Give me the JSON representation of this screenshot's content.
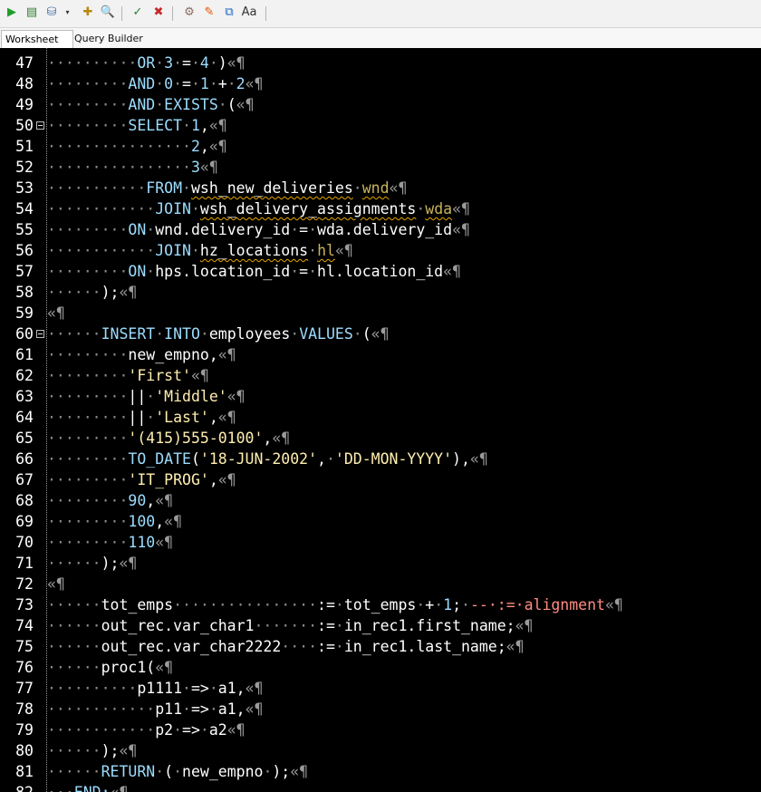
{
  "toolbar": {
    "buttons": [
      {
        "icon": "run-statement-icon",
        "glyph": "▶",
        "color": "#1f9d2b"
      },
      {
        "icon": "run-script-icon",
        "glyph": "▤",
        "color": "#2f7d2f"
      },
      {
        "icon": "commit-icon",
        "glyph": "⛁",
        "color": "#486fa8"
      },
      {
        "icon": "dropdown-arrow-icon",
        "glyph": "▾",
        "color": "#333333"
      },
      {
        "icon": "explain-plan-icon",
        "glyph": "✚",
        "color": "#b8860b"
      },
      {
        "icon": "autotrace-icon",
        "glyph": "🔍",
        "color": "#555555"
      },
      {
        "icon": "rollback-icon",
        "glyph": "✓",
        "color": "#2e7d32"
      },
      {
        "icon": "stop-icon",
        "glyph": "✖",
        "color": "#c62828"
      },
      {
        "icon": "sql-tuning-icon",
        "glyph": "⚙",
        "color": "#8d6e63"
      },
      {
        "icon": "clear-icon",
        "glyph": "✎",
        "color": "#e65100"
      },
      {
        "icon": "history-icon",
        "glyph": "⧉",
        "color": "#1565c0"
      },
      {
        "icon": "change-case-icon",
        "glyph": "Aa",
        "color": "#333333"
      }
    ]
  },
  "tabs": [
    {
      "label": "Worksheet",
      "active": true
    },
    {
      "label": "Query Builder",
      "active": false
    }
  ],
  "colors": {
    "background": "#000000",
    "keyword": "#9cdcfe",
    "string": "#ffeeb0",
    "comment": "#ff8c82",
    "whitespace_marker": "#8b8b8b",
    "squiggle": "#e6a400"
  },
  "editor": {
    "first_visible_line": 47,
    "lines": [
      {
        "n": "47",
        "fold": false,
        "tokens": [
          [
            "ws",
            "·········"
          ],
          [
            "ws",
            "·"
          ],
          [
            "kw",
            "OR"
          ],
          [
            "ws",
            "·"
          ],
          [
            "num",
            "3"
          ],
          [
            "ws",
            "·"
          ],
          [
            "op",
            "="
          ],
          [
            "ws",
            "·"
          ],
          [
            "num",
            "4"
          ],
          [
            "ws",
            "·"
          ],
          [
            "tx",
            ")"
          ],
          [
            "pm",
            "«¶"
          ]
        ]
      },
      {
        "n": "48",
        "fold": false,
        "tokens": [
          [
            "ws",
            "·········"
          ],
          [
            "kw",
            "AND"
          ],
          [
            "ws",
            "·"
          ],
          [
            "num",
            "0"
          ],
          [
            "ws",
            "·"
          ],
          [
            "op",
            "="
          ],
          [
            "ws",
            "·"
          ],
          [
            "num",
            "1"
          ],
          [
            "ws",
            "·"
          ],
          [
            "op",
            "+"
          ],
          [
            "ws",
            "·"
          ],
          [
            "num",
            "2"
          ],
          [
            "pm",
            "«¶"
          ]
        ]
      },
      {
        "n": "49",
        "fold": false,
        "tokens": [
          [
            "ws",
            "·········"
          ],
          [
            "kw",
            "AND"
          ],
          [
            "ws",
            "·"
          ],
          [
            "kw",
            "EXISTS"
          ],
          [
            "ws",
            "·"
          ],
          [
            "tx",
            "("
          ],
          [
            "pm",
            "«¶"
          ]
        ]
      },
      {
        "n": "50",
        "fold": true,
        "tokens": [
          [
            "ws",
            "·········"
          ],
          [
            "kw",
            "SELECT"
          ],
          [
            "ws",
            "·"
          ],
          [
            "num",
            "1"
          ],
          [
            "tx",
            ","
          ],
          [
            "pm",
            "«¶"
          ]
        ]
      },
      {
        "n": "51",
        "fold": false,
        "tokens": [
          [
            "ws",
            "················"
          ],
          [
            "num",
            "2"
          ],
          [
            "tx",
            ","
          ],
          [
            "pm",
            "«¶"
          ]
        ]
      },
      {
        "n": "52",
        "fold": false,
        "tokens": [
          [
            "ws",
            "················"
          ],
          [
            "num",
            "3"
          ],
          [
            "pm",
            "«¶"
          ]
        ]
      },
      {
        "n": "53",
        "fold": false,
        "tokens": [
          [
            "ws",
            "···········"
          ],
          [
            "kw",
            "FROM"
          ],
          [
            "ws",
            "·"
          ],
          [
            "ident",
            "wsh_new_deliveries"
          ],
          [
            "ws",
            "·"
          ],
          [
            "alias",
            "wnd"
          ],
          [
            "pm",
            "«¶"
          ]
        ]
      },
      {
        "n": "54",
        "fold": false,
        "tokens": [
          [
            "ws",
            "············"
          ],
          [
            "kw",
            "JOIN"
          ],
          [
            "ws",
            "·"
          ],
          [
            "ident",
            "wsh_delivery_assignments"
          ],
          [
            "ws",
            "·"
          ],
          [
            "alias",
            "wda"
          ],
          [
            "pm",
            "«¶"
          ]
        ]
      },
      {
        "n": "55",
        "fold": false,
        "tokens": [
          [
            "ws",
            "·········"
          ],
          [
            "kw",
            "ON"
          ],
          [
            "ws",
            "·"
          ],
          [
            "tx",
            "wnd.delivery_id"
          ],
          [
            "ws",
            "·"
          ],
          [
            "op",
            "="
          ],
          [
            "ws",
            "·"
          ],
          [
            "tx",
            "wda.delivery_id"
          ],
          [
            "pm",
            "«¶"
          ]
        ]
      },
      {
        "n": "56",
        "fold": false,
        "tokens": [
          [
            "ws",
            "············"
          ],
          [
            "kw",
            "JOIN"
          ],
          [
            "ws",
            "·"
          ],
          [
            "ident",
            "hz_locations"
          ],
          [
            "ws",
            "·"
          ],
          [
            "alias",
            "hl"
          ],
          [
            "pm",
            "«¶"
          ]
        ]
      },
      {
        "n": "57",
        "fold": false,
        "tokens": [
          [
            "ws",
            "·········"
          ],
          [
            "kw",
            "ON"
          ],
          [
            "ws",
            "·"
          ],
          [
            "tx",
            "hps.location_id"
          ],
          [
            "ws",
            "·"
          ],
          [
            "op",
            "="
          ],
          [
            "ws",
            "·"
          ],
          [
            "tx",
            "hl.location_id"
          ],
          [
            "pm",
            "«¶"
          ]
        ]
      },
      {
        "n": "58",
        "fold": false,
        "tokens": [
          [
            "ws",
            "······"
          ],
          [
            "tx",
            ");"
          ],
          [
            "pm",
            "«¶"
          ]
        ]
      },
      {
        "n": "59",
        "fold": false,
        "tokens": [
          [
            "pm",
            "«¶"
          ]
        ]
      },
      {
        "n": "60",
        "fold": true,
        "tokens": [
          [
            "ws",
            "······"
          ],
          [
            "kw",
            "INSERT"
          ],
          [
            "ws",
            "·"
          ],
          [
            "kw",
            "INTO"
          ],
          [
            "ws",
            "·"
          ],
          [
            "tx",
            "employees"
          ],
          [
            "ws",
            "·"
          ],
          [
            "kw",
            "VALUES"
          ],
          [
            "ws",
            "·"
          ],
          [
            "tx",
            "("
          ],
          [
            "pm",
            "«¶"
          ]
        ]
      },
      {
        "n": "61",
        "fold": false,
        "tokens": [
          [
            "ws",
            "·········"
          ],
          [
            "tx",
            "new_empno,"
          ],
          [
            "pm",
            "«¶"
          ]
        ]
      },
      {
        "n": "62",
        "fold": false,
        "tokens": [
          [
            "ws",
            "·········"
          ],
          [
            "str",
            "'First'"
          ],
          [
            "pm",
            "«¶"
          ]
        ]
      },
      {
        "n": "63",
        "fold": false,
        "tokens": [
          [
            "ws",
            "·········"
          ],
          [
            "tx",
            "||"
          ],
          [
            "ws",
            "·"
          ],
          [
            "str",
            "'Middle'"
          ],
          [
            "pm",
            "«¶"
          ]
        ]
      },
      {
        "n": "64",
        "fold": false,
        "tokens": [
          [
            "ws",
            "·········"
          ],
          [
            "tx",
            "||"
          ],
          [
            "ws",
            "·"
          ],
          [
            "str",
            "'Last'"
          ],
          [
            "tx",
            ","
          ],
          [
            "pm",
            "«¶"
          ]
        ]
      },
      {
        "n": "65",
        "fold": false,
        "tokens": [
          [
            "ws",
            "·········"
          ],
          [
            "str",
            "'(415)555-0100'"
          ],
          [
            "tx",
            ","
          ],
          [
            "pm",
            "«¶"
          ]
        ]
      },
      {
        "n": "66",
        "fold": false,
        "tokens": [
          [
            "ws",
            "·········"
          ],
          [
            "kw",
            "TO_DATE"
          ],
          [
            "tx",
            "("
          ],
          [
            "str",
            "'18-JUN-2002'"
          ],
          [
            "tx",
            ","
          ],
          [
            "ws",
            "·"
          ],
          [
            "str",
            "'DD-MON-YYYY'"
          ],
          [
            "tx",
            "),"
          ],
          [
            "pm",
            "«¶"
          ]
        ]
      },
      {
        "n": "67",
        "fold": false,
        "tokens": [
          [
            "ws",
            "·········"
          ],
          [
            "str",
            "'IT_PROG'"
          ],
          [
            "tx",
            ","
          ],
          [
            "pm",
            "«¶"
          ]
        ]
      },
      {
        "n": "68",
        "fold": false,
        "tokens": [
          [
            "ws",
            "·········"
          ],
          [
            "num",
            "90"
          ],
          [
            "tx",
            ","
          ],
          [
            "pm",
            "«¶"
          ]
        ]
      },
      {
        "n": "69",
        "fold": false,
        "tokens": [
          [
            "ws",
            "·········"
          ],
          [
            "num",
            "100"
          ],
          [
            "tx",
            ","
          ],
          [
            "pm",
            "«¶"
          ]
        ]
      },
      {
        "n": "70",
        "fold": false,
        "tokens": [
          [
            "ws",
            "·········"
          ],
          [
            "num",
            "110"
          ],
          [
            "pm",
            "«¶"
          ]
        ]
      },
      {
        "n": "71",
        "fold": false,
        "tokens": [
          [
            "ws",
            "······"
          ],
          [
            "tx",
            ");"
          ],
          [
            "pm",
            "«¶"
          ]
        ]
      },
      {
        "n": "72",
        "fold": false,
        "tokens": [
          [
            "pm",
            "«¶"
          ]
        ]
      },
      {
        "n": "73",
        "fold": false,
        "tokens": [
          [
            "ws",
            "······"
          ],
          [
            "tx",
            "tot_emps"
          ],
          [
            "ws",
            "················"
          ],
          [
            "tx",
            ":="
          ],
          [
            "ws",
            "·"
          ],
          [
            "tx",
            "tot_emps"
          ],
          [
            "ws",
            "·"
          ],
          [
            "op",
            "+"
          ],
          [
            "ws",
            "·"
          ],
          [
            "num",
            "1"
          ],
          [
            "tx",
            ";"
          ],
          [
            "ws",
            "·"
          ],
          [
            "com",
            "--·:=·alignment"
          ],
          [
            "pm",
            "«¶"
          ]
        ]
      },
      {
        "n": "74",
        "fold": false,
        "tokens": [
          [
            "ws",
            "······"
          ],
          [
            "tx",
            "out_rec.var_char1"
          ],
          [
            "ws",
            "·······"
          ],
          [
            "tx",
            ":="
          ],
          [
            "ws",
            "·"
          ],
          [
            "tx",
            "in_rec1.first_name;"
          ],
          [
            "pm",
            "«¶"
          ]
        ]
      },
      {
        "n": "75",
        "fold": false,
        "tokens": [
          [
            "ws",
            "······"
          ],
          [
            "tx",
            "out_rec.var_char2222"
          ],
          [
            "ws",
            "····"
          ],
          [
            "tx",
            ":="
          ],
          [
            "ws",
            "·"
          ],
          [
            "tx",
            "in_rec1.last_name;"
          ],
          [
            "pm",
            "«¶"
          ]
        ]
      },
      {
        "n": "76",
        "fold": false,
        "tokens": [
          [
            "ws",
            "······"
          ],
          [
            "tx",
            "proc1("
          ],
          [
            "pm",
            "«¶"
          ]
        ]
      },
      {
        "n": "77",
        "fold": false,
        "tokens": [
          [
            "ws",
            "··········"
          ],
          [
            "tx",
            "p1111"
          ],
          [
            "ws",
            "·"
          ],
          [
            "tx",
            "=>"
          ],
          [
            "ws",
            "·"
          ],
          [
            "tx",
            "a1,"
          ],
          [
            "pm",
            "«¶"
          ]
        ]
      },
      {
        "n": "78",
        "fold": false,
        "tokens": [
          [
            "ws",
            "············"
          ],
          [
            "tx",
            "p11"
          ],
          [
            "ws",
            "·"
          ],
          [
            "tx",
            "=>"
          ],
          [
            "ws",
            "·"
          ],
          [
            "tx",
            "a1,"
          ],
          [
            "pm",
            "«¶"
          ]
        ]
      },
      {
        "n": "79",
        "fold": false,
        "tokens": [
          [
            "ws",
            "············"
          ],
          [
            "tx",
            "p2"
          ],
          [
            "ws",
            "·"
          ],
          [
            "tx",
            "=>"
          ],
          [
            "ws",
            "·"
          ],
          [
            "tx",
            "a2"
          ],
          [
            "pm",
            "«¶"
          ]
        ]
      },
      {
        "n": "80",
        "fold": false,
        "tokens": [
          [
            "ws",
            "······"
          ],
          [
            "tx",
            ");"
          ],
          [
            "pm",
            "«¶"
          ]
        ]
      },
      {
        "n": "81",
        "fold": false,
        "tokens": [
          [
            "ws",
            "······"
          ],
          [
            "kw",
            "RETURN"
          ],
          [
            "ws",
            "·"
          ],
          [
            "tx",
            "("
          ],
          [
            "ws",
            "·"
          ],
          [
            "tx",
            "new_empno"
          ],
          [
            "ws",
            "·"
          ],
          [
            "tx",
            ");"
          ],
          [
            "pm",
            "«¶"
          ]
        ]
      },
      {
        "n": "82",
        "fold": false,
        "tokens": [
          [
            "ws",
            "···"
          ],
          [
            "kw",
            "END;"
          ],
          [
            "pm",
            "«¶"
          ]
        ]
      }
    ]
  }
}
